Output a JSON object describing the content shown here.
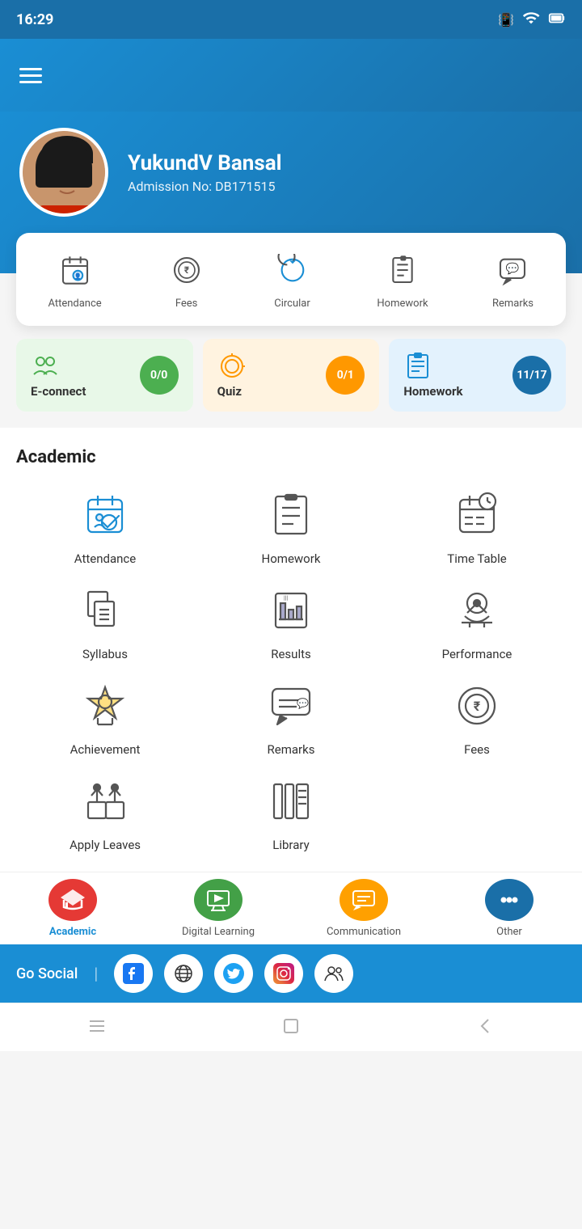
{
  "statusBar": {
    "time": "16:29",
    "icons": [
      "vibrate",
      "wifi",
      "screen",
      "battery"
    ]
  },
  "header": {
    "menuIcon": "hamburger-icon"
  },
  "profile": {
    "name": "YukundV Bansal",
    "admissionLabel": "Admission No:",
    "admissionNo": "DB171515"
  },
  "quickActions": [
    {
      "id": "attendance",
      "label": "Attendance"
    },
    {
      "id": "fees",
      "label": "Fees"
    },
    {
      "id": "circular",
      "label": "Circular"
    },
    {
      "id": "homework",
      "label": "Homework"
    },
    {
      "id": "remarks",
      "label": "Remarks"
    }
  ],
  "stats": [
    {
      "id": "econnect",
      "label": "E-connect",
      "value": "0/0",
      "badgeClass": "badge-green"
    },
    {
      "id": "quiz",
      "label": "Quiz",
      "value": "0/1",
      "badgeClass": "badge-orange"
    },
    {
      "id": "homework",
      "label": "Homework",
      "value": "11/17",
      "badgeClass": "badge-dark-blue"
    }
  ],
  "academic": {
    "title": "Academic",
    "items": [
      {
        "id": "attendance",
        "label": "Attendance"
      },
      {
        "id": "homework",
        "label": "Homework"
      },
      {
        "id": "timetable",
        "label": "Time Table"
      },
      {
        "id": "syllabus",
        "label": "Syllabus"
      },
      {
        "id": "results",
        "label": "Results"
      },
      {
        "id": "performance",
        "label": "Performance"
      },
      {
        "id": "achievement",
        "label": "Achievement"
      },
      {
        "id": "remarks",
        "label": "Remarks"
      },
      {
        "id": "fees",
        "label": "Fees"
      },
      {
        "id": "applyleaves",
        "label": "Apply Leaves"
      },
      {
        "id": "library",
        "label": "Library"
      }
    ]
  },
  "bottomNav": [
    {
      "id": "academic",
      "label": "Academic",
      "active": true,
      "color": "red"
    },
    {
      "id": "digital-learning",
      "label": "Digital Learning",
      "active": false,
      "color": "green"
    },
    {
      "id": "communication",
      "label": "Communication",
      "active": false,
      "color": "amber"
    },
    {
      "id": "other",
      "label": "Other",
      "active": false,
      "color": "blue"
    }
  ],
  "goSocial": {
    "label": "Go Social",
    "socialLinks": [
      "facebook",
      "globe",
      "twitter",
      "instagram",
      "people"
    ]
  },
  "androidNav": [
    "menu",
    "square",
    "back"
  ]
}
